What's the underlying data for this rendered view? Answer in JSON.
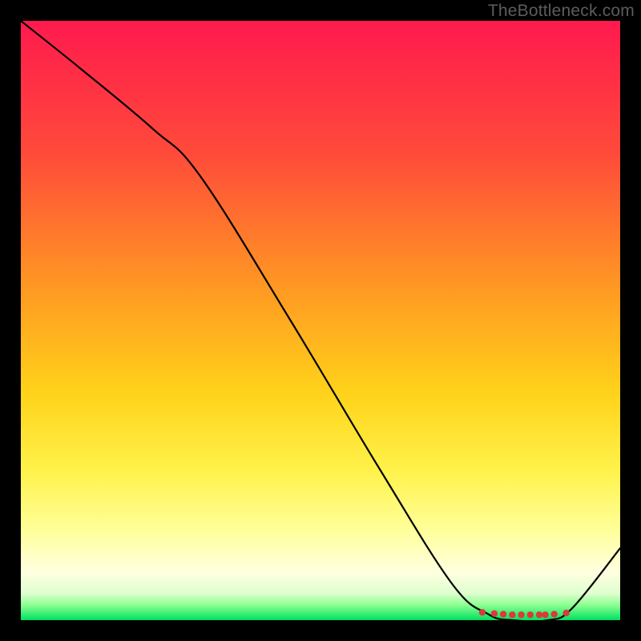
{
  "watermark": "TheBottleneck.com",
  "chart_data": {
    "type": "line",
    "title": "",
    "xlabel": "",
    "ylabel": "",
    "xlim": [
      0,
      100
    ],
    "ylim": [
      0,
      100
    ],
    "grid": false,
    "legend": null,
    "background_gradient_stops": [
      {
        "offset": 0,
        "color": "#ff1a4e"
      },
      {
        "offset": 0.22,
        "color": "#ff4a3a"
      },
      {
        "offset": 0.45,
        "color": "#ff9a22"
      },
      {
        "offset": 0.62,
        "color": "#ffd21a"
      },
      {
        "offset": 0.75,
        "color": "#fff24a"
      },
      {
        "offset": 0.85,
        "color": "#ffff9a"
      },
      {
        "offset": 0.92,
        "color": "#ffffe0"
      },
      {
        "offset": 0.955,
        "color": "#e0ffd0"
      },
      {
        "offset": 0.975,
        "color": "#8aff90"
      },
      {
        "offset": 1.0,
        "color": "#00e060"
      }
    ],
    "series": [
      {
        "name": "curve",
        "x": [
          0,
          10,
          22,
          30,
          45,
          60,
          72,
          78,
          82,
          88,
          92,
          100
        ],
        "y": [
          100,
          92,
          82,
          74,
          50,
          25,
          6,
          1,
          0,
          0,
          2,
          12
        ]
      }
    ],
    "markers": {
      "name": "flat-bottom-markers",
      "color": "#d93a3a",
      "x": [
        77,
        79,
        80.5,
        82,
        83.5,
        85,
        86.5,
        87.5,
        89,
        91
      ],
      "y": [
        1.3,
        1.1,
        1.0,
        0.9,
        0.9,
        0.9,
        0.9,
        0.9,
        1.0,
        1.2
      ]
    }
  }
}
